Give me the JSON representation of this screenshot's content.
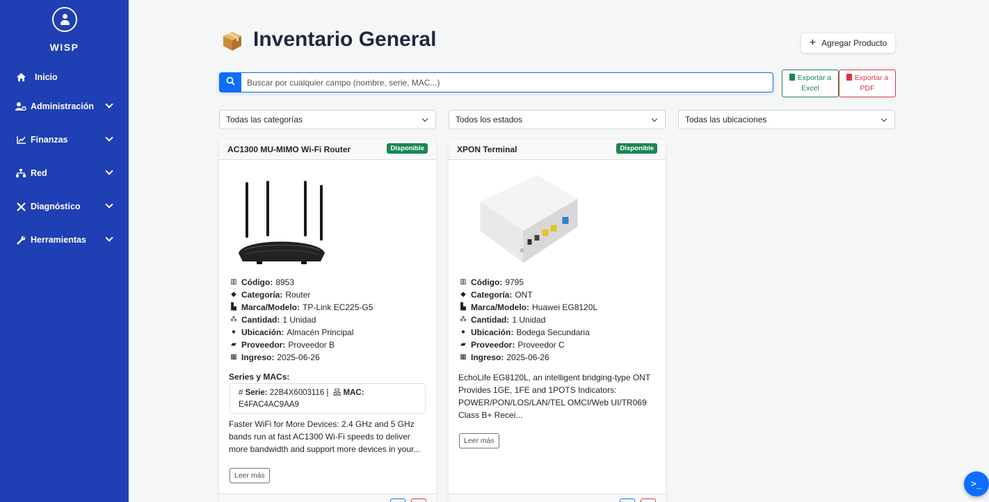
{
  "sidebar": {
    "brand": "WISP",
    "items": [
      {
        "label": "Inicio",
        "icon": "home-icon"
      },
      {
        "label": "Administración",
        "icon": "users-cog-icon"
      },
      {
        "label": "Finanzas",
        "icon": "chart-line-icon"
      },
      {
        "label": "Red",
        "icon": "network-icon"
      },
      {
        "label": "Diagnóstico",
        "icon": "tools-icon"
      },
      {
        "label": "Herramientas",
        "icon": "wrench-icon"
      }
    ]
  },
  "header": {
    "title": "Inventario General",
    "add_button": "Agregar Producto"
  },
  "search": {
    "placeholder": "Buscar por cualquier campo (nombre, serie, MAC...)",
    "value": ""
  },
  "export": {
    "excel": "Exportar a Excel",
    "pdf": "Exportar a PDF"
  },
  "filters": {
    "category": "Todas las categorías",
    "status": "Todos los estados",
    "location": "Todas las ubicaciones"
  },
  "labels": {
    "code": "Código:",
    "category": "Categoría:",
    "brand_model": "Marca/Modelo:",
    "quantity": "Cantidad:",
    "location": "Ubicación:",
    "supplier": "Proveedor:",
    "entry": "Ingreso:",
    "series_title": "Series y MACs:",
    "serie": "Serie:",
    "mac": "MAC:",
    "read_more": "Leer más"
  },
  "products": [
    {
      "name": "AC1300 MU-MIMO Wi-Fi Router",
      "status": "Disponible",
      "code": "8953",
      "category": "Router",
      "brand_model": "TP-Link EC225-G5",
      "quantity": "1 Unidad",
      "location": "Almacén Principal",
      "supplier": "Proveedor B",
      "entry": "2025-06-26",
      "serie": "22B4X6003116 |",
      "mac": "E4FAC4AC9AA9",
      "description": "Faster WiFi for More Devices: 2.4 GHz and 5 GHz bands run at fast AC1300 Wi-Fi speeds to deliver more bandwidth and support more devices in your..."
    },
    {
      "name": "XPON Terminal",
      "status": "Disponible",
      "code": "9795",
      "category": "ONT",
      "brand_model": "Huawei EG8120L",
      "quantity": "1 Unidad",
      "location": "Bodega Secundaria",
      "supplier": "Proveedor C",
      "entry": "2025-06-26",
      "description": "EchoLife EG8120L, an intelligent bridging-type ONT Provides 1GE, 1FE and 1POTS Indicators: POWER/PON/LOS/LAN/TEL OMCI/Web UI/TR069 Class B+ Recei..."
    }
  ],
  "terminal_button": ">_",
  "colors": {
    "sidebar": "#1f3fb4",
    "primary": "#0d6efd",
    "success": "#198754",
    "danger": "#dc3545"
  }
}
